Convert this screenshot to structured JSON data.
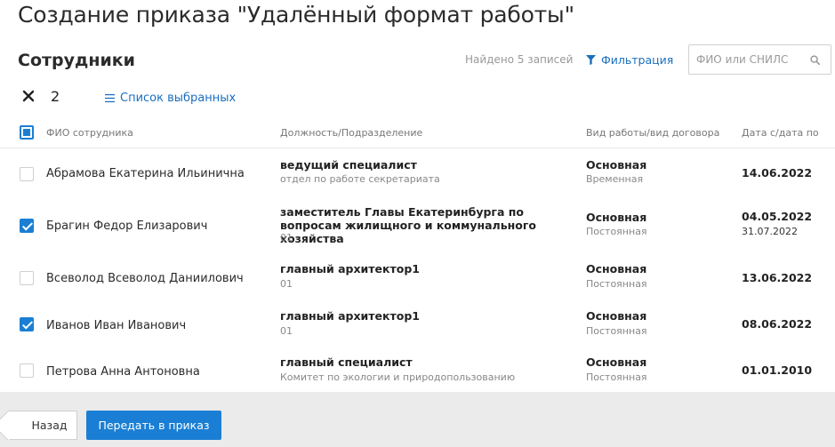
{
  "page": {
    "title": "Создание приказа \"Удалённый формат работы\"",
    "section_title": "Сотрудники"
  },
  "toolbar": {
    "found_text": "Найдено 5 записей",
    "filter_label": "Фильтрация",
    "search_placeholder": "ФИО или СНИЛС"
  },
  "selection": {
    "count": "2",
    "list_label": "Список выбранных"
  },
  "table": {
    "columns": {
      "name": "ФИО сотрудника",
      "position": "Должность/Подразделение",
      "work_type": "Вид работы/вид договора",
      "dates": "Дата с/дата по"
    },
    "rows": [
      {
        "checked": false,
        "name": "Абрамова Екатерина Ильинична",
        "position": "ведущий специалист",
        "department": "отдел по работе секретариата",
        "work_type": "Основная",
        "contract": "Временная",
        "date_from": "14.06.2022",
        "date_to": ""
      },
      {
        "checked": true,
        "name": "Брагин Федор Елизарович",
        "position": "заместитель Главы Екатеринбурга по вопросам жилищного и коммунального хозяйства",
        "department": "01",
        "work_type": "Основная",
        "contract": "Постоянная",
        "date_from": "04.05.2022",
        "date_to": "31.07.2022"
      },
      {
        "checked": false,
        "name": "Всеволод Всеволод Даниилович",
        "position": "главный архитектор1",
        "department": "01",
        "work_type": "Основная",
        "contract": "Постоянная",
        "date_from": "13.06.2022",
        "date_to": ""
      },
      {
        "checked": true,
        "name": "Иванов Иван Иванович",
        "position": "главный архитектор1",
        "department": "01",
        "work_type": "Основная",
        "contract": "Постоянная",
        "date_from": "08.06.2022",
        "date_to": ""
      },
      {
        "checked": false,
        "name": "Петрова Анна Антоновна",
        "position": "главный специалист",
        "department": "Комитет по экологии и природопользованию",
        "work_type": "Основная",
        "contract": "Постоянная",
        "date_from": "01.01.2010",
        "date_to": ""
      }
    ]
  },
  "footer": {
    "back_label": "Назад",
    "submit_label": "Передать в приказ"
  },
  "colors": {
    "accent": "#1a7fd4",
    "link": "#1a6fbf",
    "footer_bg": "#ebebeb"
  }
}
